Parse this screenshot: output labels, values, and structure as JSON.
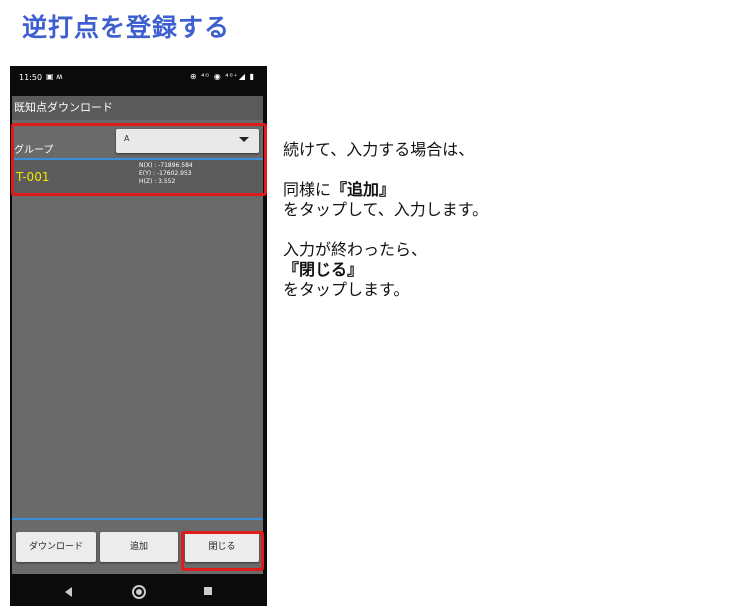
{
  "page": {
    "title": "逆打点を登録する"
  },
  "phone": {
    "status_time": "11:50",
    "status_icons": "▣ ʍ",
    "status_right": "⊕ ⁴ᴳ ◉ ⁴⁰⁺◢ ▮",
    "screen_title": "既知点ダウンロード",
    "group_label": "グループ",
    "group_value": "A",
    "point": {
      "name": "T-001",
      "nx": "N(X) : -71896.584",
      "ey": "E(Y) : -17602.953",
      "hz": "H(Z) : 3.552"
    },
    "buttons": {
      "download": "ダウンロード",
      "add": "追加",
      "close": "閉じる"
    }
  },
  "instructions": {
    "line1": "続けて、入力する場合は、",
    "line2_prefix": "同様に",
    "line2_bold": "『追加』",
    "line3": "をタップして、入力します。",
    "line4": "入力が終わったら、",
    "line5_bold": "『閉じる』",
    "line6": "をタップします。"
  },
  "colors": {
    "title": "#3d5fcf",
    "highlight": "#e01b1b",
    "point_name": "#f5e600",
    "accent_line": "#3b8fd8"
  }
}
